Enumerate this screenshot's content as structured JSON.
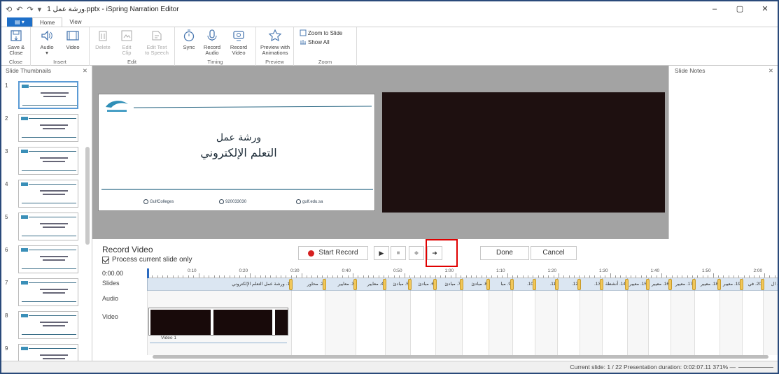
{
  "window": {
    "title": "ورشة عمل 1.pptx - iSpring Narration Editor",
    "minimize": "–",
    "maximize": "▢",
    "close": "✕"
  },
  "quick_access": [
    "⟲",
    "↶",
    "↷",
    "▾"
  ],
  "tabs": {
    "file": "▤ ▾",
    "items": [
      "Home",
      "View"
    ],
    "active": "Home"
  },
  "ribbon": {
    "groups": [
      {
        "name": "Close",
        "buttons": [
          {
            "l1": "Save &",
            "l2": "Close"
          }
        ]
      },
      {
        "name": "Insert",
        "buttons": [
          {
            "l1": "Audio",
            "l2": "▾"
          },
          {
            "l1": "Video",
            "l2": ""
          }
        ]
      },
      {
        "name": "Edit",
        "buttons": [
          {
            "l1": "Delete",
            "l2": ""
          },
          {
            "l1": "Edit",
            "l2": "Clip"
          },
          {
            "l1": "Edit Text",
            "l2": "to Speech"
          }
        ]
      },
      {
        "name": "Timing",
        "buttons": [
          {
            "l1": "Sync",
            "l2": ""
          },
          {
            "l1": "Record",
            "l2": "Audio"
          },
          {
            "l1": "Record",
            "l2": "Video"
          }
        ]
      },
      {
        "name": "Preview",
        "buttons": [
          {
            "l1": "Preview with",
            "l2": "Animations"
          }
        ]
      },
      {
        "name": "Zoom",
        "buttons": [
          {
            "l1": "Zoom to Slide"
          },
          {
            "l1": "Show All"
          }
        ]
      }
    ]
  },
  "thumbnails": {
    "title": "Slide Thumbnails",
    "close": "✕",
    "numbers": [
      "1",
      "2",
      "3",
      "4",
      "5",
      "6",
      "7",
      "8",
      "9"
    ]
  },
  "slide": {
    "title_line1": "ورشة عمل",
    "title_line2": "التعلم الإلكتروني",
    "footer": [
      "GulfColleges",
      "920033030",
      "gulf.edu.sa"
    ]
  },
  "notes": {
    "title": "Slide Notes",
    "close": "✕"
  },
  "record": {
    "title": "Record Video",
    "process_label": "Process current slide only",
    "start": "Start Record",
    "done": "Done",
    "cancel": "Cancel",
    "time": "0:00.00",
    "rows": [
      "Slides",
      "Audio",
      "Video"
    ],
    "video_clip_label": "Video 1"
  },
  "timeline": {
    "ticks": [
      "0:10",
      "0:20",
      "0:30",
      "0:40",
      "0:50",
      "1:00",
      "1:10",
      "1:20",
      "1:30",
      "1:40",
      "1:50",
      "2:00"
    ],
    "segments": [
      "1. ورشة عمل التعلم الإلكتروني",
      "2. محاور",
      "3. معايير",
      "4. معايير",
      "5. مبادئ",
      "6. مبادئ",
      "7. مبادئ",
      "8. مبادئ",
      "9. مبا",
      "10.",
      "11.",
      "12.",
      "13.",
      "14. أنشطة",
      "15. معيير",
      "16. معيير",
      "17. معيير",
      "18. معيير",
      "19. معيير",
      "20. في",
      "21. ال"
    ]
  },
  "status": {
    "text": "Current slide: 1 / 22   Presentation duration: 0:02:07.11   371%   —"
  }
}
